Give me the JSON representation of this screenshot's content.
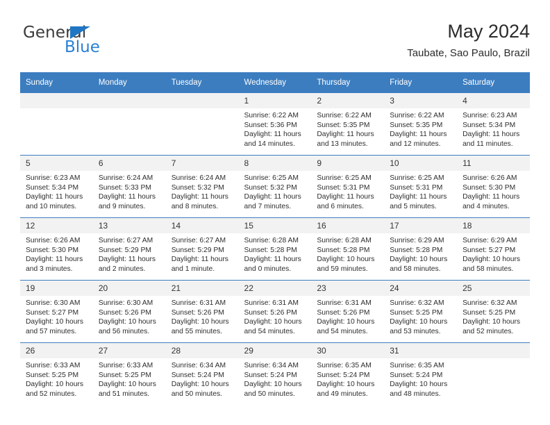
{
  "logo": {
    "general_text": "General",
    "blue_text": "Blue",
    "triangle_color": "#1f76c4",
    "blue_color": "#2980d6"
  },
  "header": {
    "title": "May 2024",
    "subtitle": "Taubate, Sao Paulo, Brazil"
  },
  "theme": {
    "header_blue": "#3c7dc0",
    "daynum_band": "#f2f2f2",
    "text": "#2d2d2d"
  },
  "weekday_headers": [
    "Sunday",
    "Monday",
    "Tuesday",
    "Wednesday",
    "Thursday",
    "Friday",
    "Saturday"
  ],
  "labels": {
    "sunrise_prefix": "Sunrise:",
    "sunset_prefix": "Sunset:",
    "daylight_prefix": "Daylight:"
  },
  "weeks": [
    [
      {
        "day": "",
        "empty": true
      },
      {
        "day": "",
        "empty": true
      },
      {
        "day": "",
        "empty": true
      },
      {
        "day": "1",
        "sunrise": "Sunrise: 6:22 AM",
        "sunset": "Sunset: 5:36 PM",
        "daylight": "Daylight: 11 hours and 14 minutes."
      },
      {
        "day": "2",
        "sunrise": "Sunrise: 6:22 AM",
        "sunset": "Sunset: 5:35 PM",
        "daylight": "Daylight: 11 hours and 13 minutes."
      },
      {
        "day": "3",
        "sunrise": "Sunrise: 6:22 AM",
        "sunset": "Sunset: 5:35 PM",
        "daylight": "Daylight: 11 hours and 12 minutes."
      },
      {
        "day": "4",
        "sunrise": "Sunrise: 6:23 AM",
        "sunset": "Sunset: 5:34 PM",
        "daylight": "Daylight: 11 hours and 11 minutes."
      }
    ],
    [
      {
        "day": "5",
        "sunrise": "Sunrise: 6:23 AM",
        "sunset": "Sunset: 5:34 PM",
        "daylight": "Daylight: 11 hours and 10 minutes."
      },
      {
        "day": "6",
        "sunrise": "Sunrise: 6:24 AM",
        "sunset": "Sunset: 5:33 PM",
        "daylight": "Daylight: 11 hours and 9 minutes."
      },
      {
        "day": "7",
        "sunrise": "Sunrise: 6:24 AM",
        "sunset": "Sunset: 5:32 PM",
        "daylight": "Daylight: 11 hours and 8 minutes."
      },
      {
        "day": "8",
        "sunrise": "Sunrise: 6:25 AM",
        "sunset": "Sunset: 5:32 PM",
        "daylight": "Daylight: 11 hours and 7 minutes."
      },
      {
        "day": "9",
        "sunrise": "Sunrise: 6:25 AM",
        "sunset": "Sunset: 5:31 PM",
        "daylight": "Daylight: 11 hours and 6 minutes."
      },
      {
        "day": "10",
        "sunrise": "Sunrise: 6:25 AM",
        "sunset": "Sunset: 5:31 PM",
        "daylight": "Daylight: 11 hours and 5 minutes."
      },
      {
        "day": "11",
        "sunrise": "Sunrise: 6:26 AM",
        "sunset": "Sunset: 5:30 PM",
        "daylight": "Daylight: 11 hours and 4 minutes."
      }
    ],
    [
      {
        "day": "12",
        "sunrise": "Sunrise: 6:26 AM",
        "sunset": "Sunset: 5:30 PM",
        "daylight": "Daylight: 11 hours and 3 minutes."
      },
      {
        "day": "13",
        "sunrise": "Sunrise: 6:27 AM",
        "sunset": "Sunset: 5:29 PM",
        "daylight": "Daylight: 11 hours and 2 minutes."
      },
      {
        "day": "14",
        "sunrise": "Sunrise: 6:27 AM",
        "sunset": "Sunset: 5:29 PM",
        "daylight": "Daylight: 11 hours and 1 minute."
      },
      {
        "day": "15",
        "sunrise": "Sunrise: 6:28 AM",
        "sunset": "Sunset: 5:28 PM",
        "daylight": "Daylight: 11 hours and 0 minutes."
      },
      {
        "day": "16",
        "sunrise": "Sunrise: 6:28 AM",
        "sunset": "Sunset: 5:28 PM",
        "daylight": "Daylight: 10 hours and 59 minutes."
      },
      {
        "day": "17",
        "sunrise": "Sunrise: 6:29 AM",
        "sunset": "Sunset: 5:28 PM",
        "daylight": "Daylight: 10 hours and 58 minutes."
      },
      {
        "day": "18",
        "sunrise": "Sunrise: 6:29 AM",
        "sunset": "Sunset: 5:27 PM",
        "daylight": "Daylight: 10 hours and 58 minutes."
      }
    ],
    [
      {
        "day": "19",
        "sunrise": "Sunrise: 6:30 AM",
        "sunset": "Sunset: 5:27 PM",
        "daylight": "Daylight: 10 hours and 57 minutes."
      },
      {
        "day": "20",
        "sunrise": "Sunrise: 6:30 AM",
        "sunset": "Sunset: 5:26 PM",
        "daylight": "Daylight: 10 hours and 56 minutes."
      },
      {
        "day": "21",
        "sunrise": "Sunrise: 6:31 AM",
        "sunset": "Sunset: 5:26 PM",
        "daylight": "Daylight: 10 hours and 55 minutes."
      },
      {
        "day": "22",
        "sunrise": "Sunrise: 6:31 AM",
        "sunset": "Sunset: 5:26 PM",
        "daylight": "Daylight: 10 hours and 54 minutes."
      },
      {
        "day": "23",
        "sunrise": "Sunrise: 6:31 AM",
        "sunset": "Sunset: 5:26 PM",
        "daylight": "Daylight: 10 hours and 54 minutes."
      },
      {
        "day": "24",
        "sunrise": "Sunrise: 6:32 AM",
        "sunset": "Sunset: 5:25 PM",
        "daylight": "Daylight: 10 hours and 53 minutes."
      },
      {
        "day": "25",
        "sunrise": "Sunrise: 6:32 AM",
        "sunset": "Sunset: 5:25 PM",
        "daylight": "Daylight: 10 hours and 52 minutes."
      }
    ],
    [
      {
        "day": "26",
        "sunrise": "Sunrise: 6:33 AM",
        "sunset": "Sunset: 5:25 PM",
        "daylight": "Daylight: 10 hours and 52 minutes."
      },
      {
        "day": "27",
        "sunrise": "Sunrise: 6:33 AM",
        "sunset": "Sunset: 5:25 PM",
        "daylight": "Daylight: 10 hours and 51 minutes."
      },
      {
        "day": "28",
        "sunrise": "Sunrise: 6:34 AM",
        "sunset": "Sunset: 5:24 PM",
        "daylight": "Daylight: 10 hours and 50 minutes."
      },
      {
        "day": "29",
        "sunrise": "Sunrise: 6:34 AM",
        "sunset": "Sunset: 5:24 PM",
        "daylight": "Daylight: 10 hours and 50 minutes."
      },
      {
        "day": "30",
        "sunrise": "Sunrise: 6:35 AM",
        "sunset": "Sunset: 5:24 PM",
        "daylight": "Daylight: 10 hours and 49 minutes."
      },
      {
        "day": "31",
        "sunrise": "Sunrise: 6:35 AM",
        "sunset": "Sunset: 5:24 PM",
        "daylight": "Daylight: 10 hours and 48 minutes."
      },
      {
        "day": "",
        "empty": true
      }
    ]
  ]
}
